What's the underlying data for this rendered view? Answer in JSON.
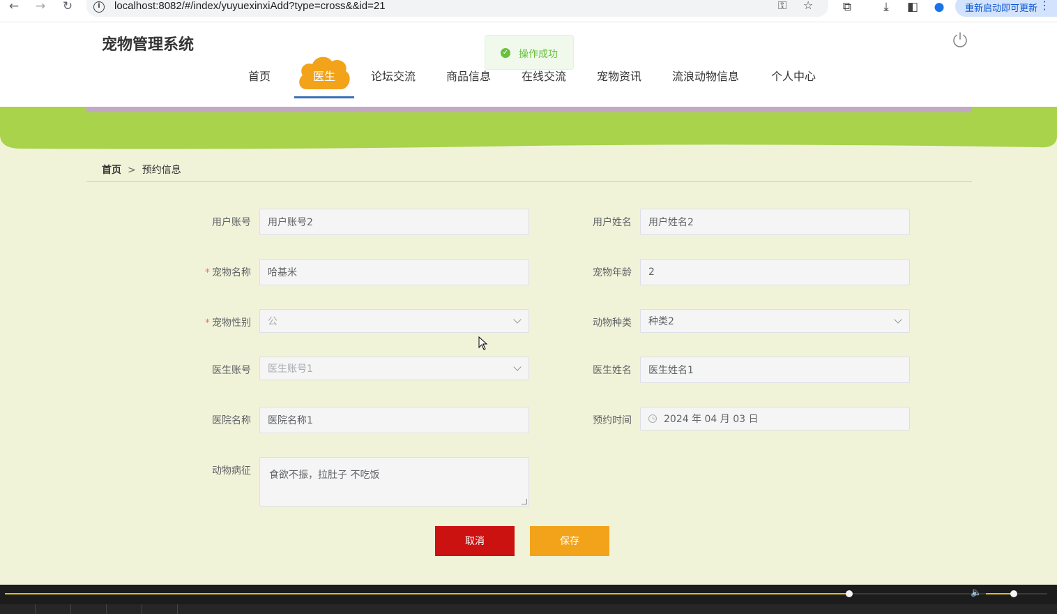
{
  "browser": {
    "url": "localhost:8082/#/index/yuyuexinxiAdd?type=cross&&id=21",
    "update_label": "重新启动即可更新"
  },
  "site": {
    "title": "宠物管理系统",
    "nav": [
      "首页",
      "医生",
      "论坛交流",
      "商品信息",
      "在线交流",
      "宠物资讯",
      "流浪动物信息",
      "个人中心"
    ],
    "active_nav": "医生"
  },
  "toast": {
    "message": "操作成功"
  },
  "breadcrumb": {
    "home": "首页",
    "separator": ">",
    "current": "预约信息"
  },
  "form": {
    "user_account": {
      "label": "用户账号",
      "value": "用户账号2"
    },
    "user_name": {
      "label": "用户姓名",
      "value": "用户姓名2"
    },
    "pet_name": {
      "label": "宠物名称",
      "value": "哈基米",
      "required": true
    },
    "pet_age": {
      "label": "宠物年龄",
      "value": "2"
    },
    "pet_gender": {
      "label": "宠物性别",
      "value": "公",
      "required": true
    },
    "animal_type": {
      "label": "动物种类",
      "value": "种类2"
    },
    "doctor_account": {
      "label": "医生账号",
      "value": "医生账号1"
    },
    "doctor_name": {
      "label": "医生姓名",
      "value": "医生姓名1"
    },
    "hospital_name": {
      "label": "医院名称",
      "value": "医院名称1"
    },
    "appointment_time": {
      "label": "预约时间",
      "value": "2024 年 04 月 03 日"
    },
    "symptoms": {
      "label": "动物病征",
      "value": "食欲不振，拉肚子 不吃饭"
    }
  },
  "buttons": {
    "cancel": "取消",
    "save": "保存"
  },
  "video": {
    "progress": 0.81,
    "volume": 0.45
  },
  "colors": {
    "banner_green": "#a8d34a",
    "page_bg": "#f1f3d9",
    "cancel": "#cc1111",
    "save": "#f2a31a",
    "active_nav_blob": "#f2a31a",
    "success": "#67c23a"
  }
}
